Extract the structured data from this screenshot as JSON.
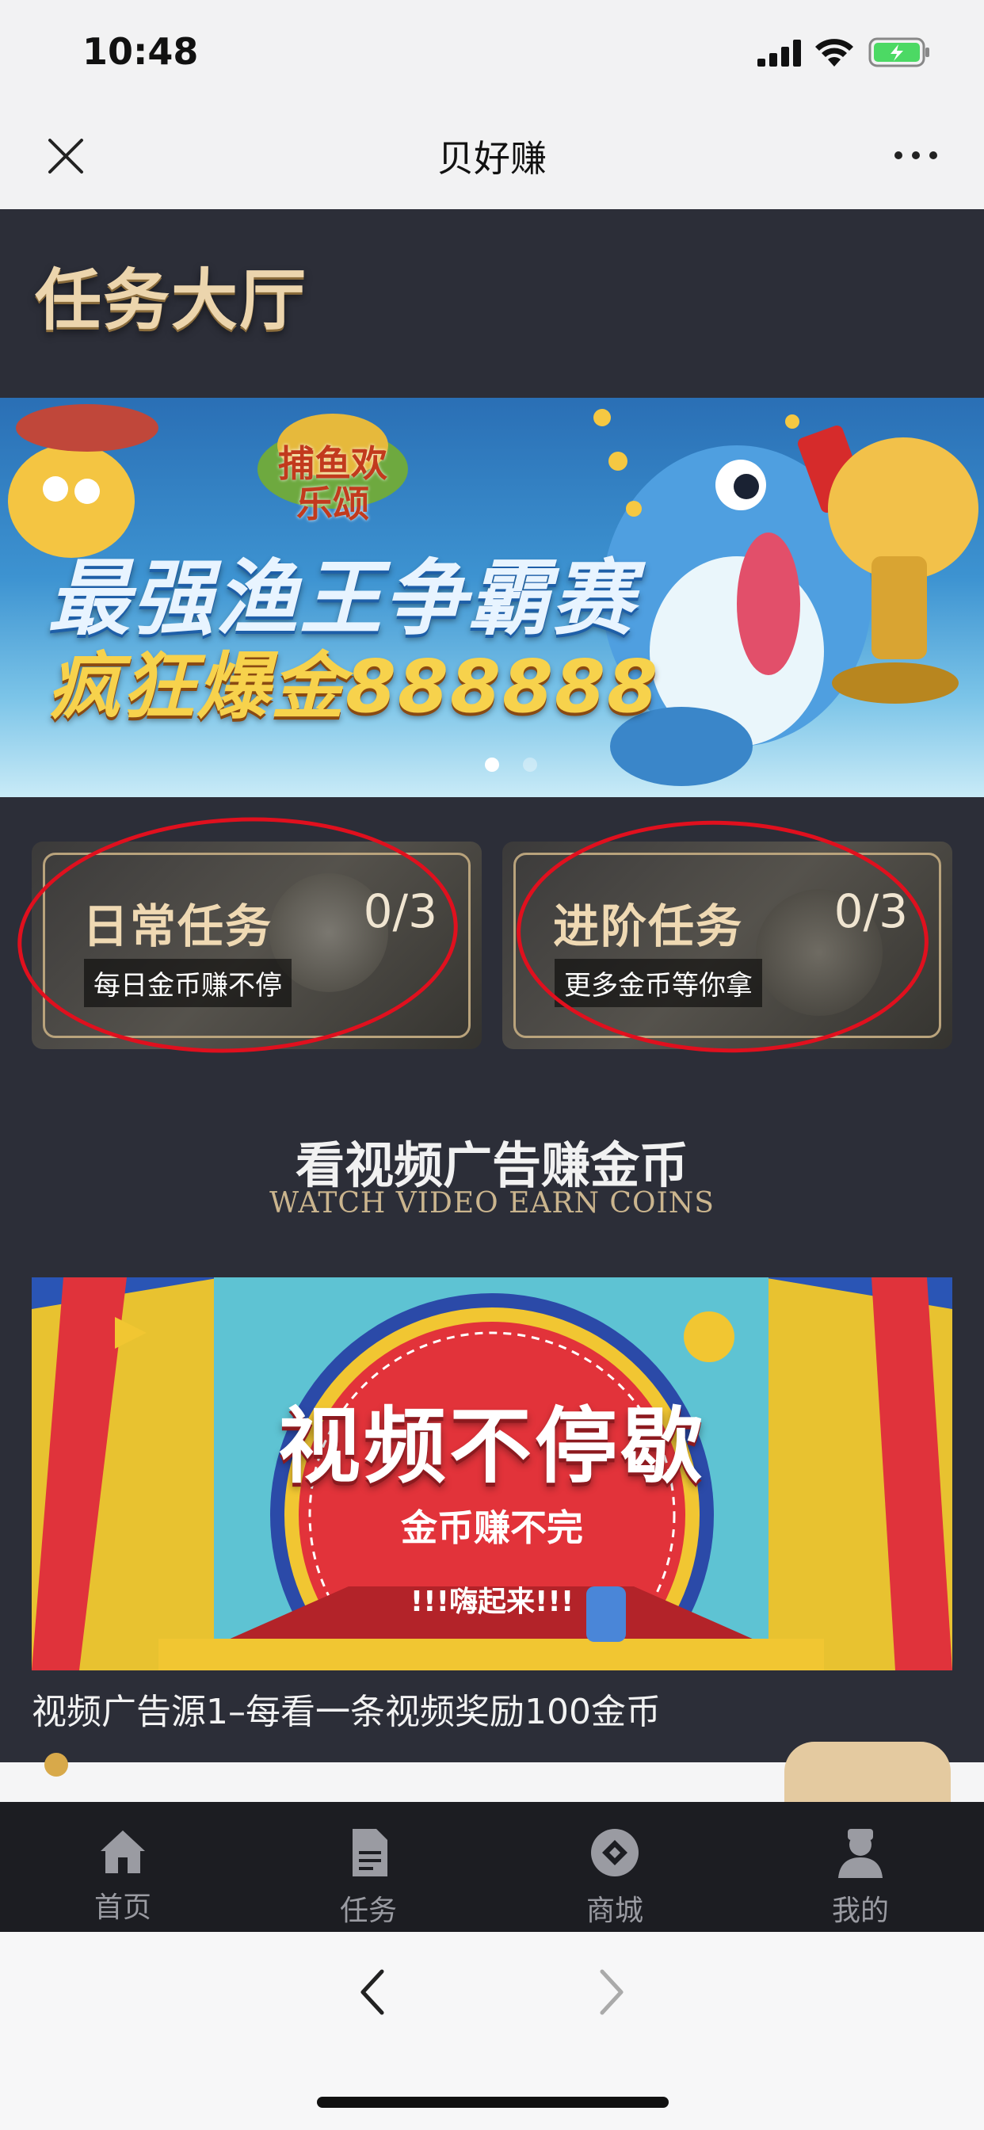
{
  "status": {
    "time": "10:48"
  },
  "nav": {
    "title": "贝好赚"
  },
  "hall": {
    "title": "任务大厅"
  },
  "banner": {
    "logo": "捕鱼欢乐颂",
    "line1": "最强渔王争霸赛",
    "line2": "疯狂爆金888888",
    "page_count": 2,
    "active_page": 1
  },
  "tasks": [
    {
      "title": "日常任务",
      "count": "0/3",
      "subtitle": "每日金币赚不停"
    },
    {
      "title": "进阶任务",
      "count": "0/3",
      "subtitle": "更多金币等你拿"
    }
  ],
  "section": {
    "title": "看视频广告赚金币",
    "subtitle": "WATCH VIDEO  EARN COINS"
  },
  "video": {
    "headline": "视频不停歇",
    "tagline": "金币赚不完",
    "cheer": "!!!嗨起来!!!",
    "caption": "视频广告源1–每看一条视频奖励100金币"
  },
  "tabbar": [
    {
      "label": "首页",
      "icon": "home-icon"
    },
    {
      "label": "任务",
      "icon": "document-icon"
    },
    {
      "label": "商城",
      "icon": "store-icon"
    },
    {
      "label": "我的",
      "icon": "profile-icon"
    }
  ],
  "colors": {
    "accent_red": "#e0101e",
    "gold": "#ecd5ad",
    "dark_bg": "#2c2e38"
  }
}
